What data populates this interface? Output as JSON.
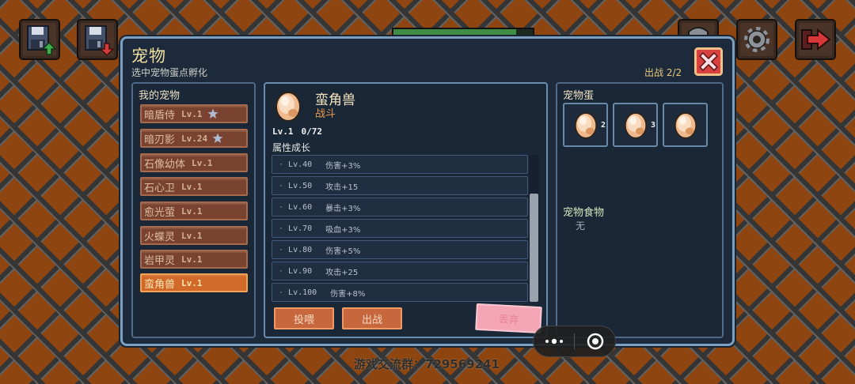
{
  "colors": {
    "background": "#8e4510",
    "lattice": "#353535",
    "dialog_bg": "#1c2a3b",
    "dialog_border": "#7ba0c0",
    "title": "#f3dfa0",
    "item_bg": "#7a4331",
    "item_selected_bg": "#d0692a",
    "button_bg": "#c6673e",
    "discard_button": "#f4a6b6",
    "close_button": "#d94040"
  },
  "hud": {
    "icons": [
      "save-upload-icon",
      "save-download-icon",
      "inventory-icon",
      "gear-icon",
      "exit-arrow-icon"
    ],
    "exp_fill": 0.88
  },
  "dialog": {
    "title": "宠物",
    "subtitle": "选中宠物蛋点孵化",
    "deploy_count": "出战 2/2",
    "close_icon": "close-icon"
  },
  "my_pets": {
    "header": "我的宠物",
    "items": [
      {
        "name": "暗盾侍",
        "level": "Lv.1",
        "starred": true,
        "selected": false
      },
      {
        "name": "暗刃影",
        "level": "Lv.24",
        "starred": true,
        "selected": false
      },
      {
        "name": "石像幼体",
        "level": "Lv.1",
        "starred": false,
        "selected": false
      },
      {
        "name": "石心卫",
        "level": "Lv.1",
        "starred": false,
        "selected": false
      },
      {
        "name": "愈光萤",
        "level": "Lv.1",
        "starred": false,
        "selected": false
      },
      {
        "name": "火蝶灵",
        "level": "Lv.1",
        "starred": false,
        "selected": false
      },
      {
        "name": "岩甲灵",
        "level": "Lv.1",
        "starred": false,
        "selected": false
      },
      {
        "name": "蛮角兽",
        "level": "Lv.1",
        "starred": false,
        "selected": true
      }
    ]
  },
  "detail": {
    "icon": "egg-icon",
    "name": "蛮角兽",
    "type": "战斗",
    "level": "Lv.1",
    "exp": "0/72",
    "growth_header": "属性成长",
    "growth": [
      {
        "level": "Lv.40",
        "bonus": "伤害+3%"
      },
      {
        "level": "Lv.50",
        "bonus": "攻击+15"
      },
      {
        "level": "Lv.60",
        "bonus": "暴击+3%"
      },
      {
        "level": "Lv.70",
        "bonus": "吸血+3%"
      },
      {
        "level": "Lv.80",
        "bonus": "伤害+5%"
      },
      {
        "level": "Lv.90",
        "bonus": "攻击+25"
      },
      {
        "level": "Lv.100",
        "bonus": "伤害+8%"
      }
    ],
    "buttons": {
      "feed": "投喂",
      "deploy": "出战",
      "discard": "丢弃"
    }
  },
  "eggs": {
    "header": "宠物蛋",
    "slots": [
      {
        "icon": "egg-icon",
        "count": "2"
      },
      {
        "icon": "egg-icon",
        "count": "3"
      },
      {
        "icon": "egg-icon"
      }
    ]
  },
  "food": {
    "header": "宠物食物",
    "value": "无"
  },
  "capsule": {
    "more_icon": "more-dots-icon",
    "close_icon": "target-circle-icon"
  },
  "footer": "游戏交流群：729569241"
}
